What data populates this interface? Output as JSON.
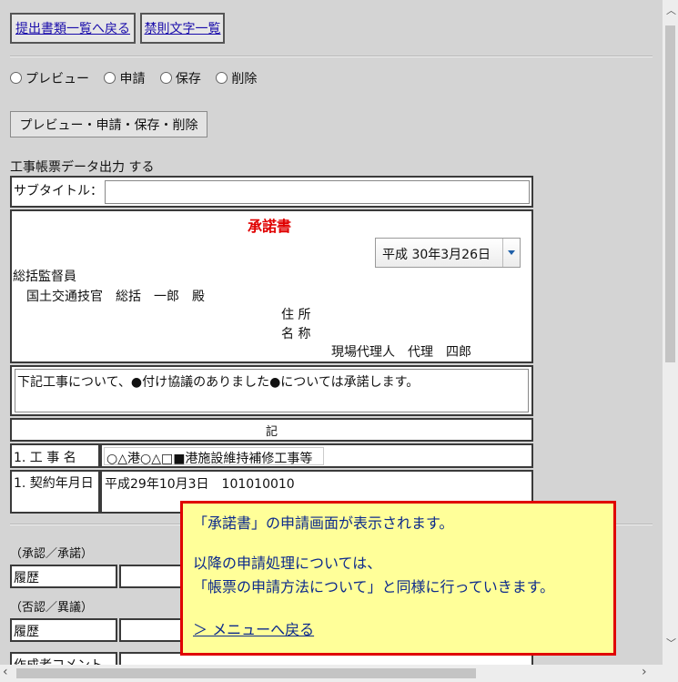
{
  "toolbar": {
    "back_to_list": "提出書類一覧へ戻る",
    "forbidden_chars": "禁則文字一覧"
  },
  "actions": {
    "radios": [
      "プレビュー",
      "申請",
      "保存",
      "削除"
    ],
    "submit_label": "プレビュー・申請・保存・削除"
  },
  "form": {
    "output_label": "工事帳票データ出力 する",
    "subtitle_label": "サブタイトル：",
    "subtitle_value": "",
    "doc_title": "承諾書",
    "date_value": "平成 30年3月26日",
    "addressee_title": "総括監督員",
    "addressee_name": "国土交通技官　総括　一郎　殿",
    "address_label": "住 所",
    "name_label": "名 称",
    "agent": "現場代理人　代理　四郎",
    "body_text": "下記工事について、●付け協議のありました●については承諾します。",
    "ki": "記",
    "row1_label": "1. 工 事 名",
    "row1_value": "○△港○△□■港施設維持補修工事等",
    "row2_label": "1. 契約年月日",
    "row2_value": "平成29年10月3日　101010010"
  },
  "history": {
    "approval_heading": "（承認／承諾）",
    "approval_label": "履歴",
    "denial_heading": "（否認／異議）",
    "denial_label": "履歴",
    "comment_label": "作成者コメント"
  },
  "popup": {
    "line1": "「承諾書」の申請画面が表示されます。",
    "line2": "以降の申請処理については、",
    "line3": "「帳票の申請方法について」と同様に行っていきます。",
    "link": "＞ メニューへ戻る"
  },
  "colors": {
    "title_red": "#e00000",
    "popup_bg": "#ffff99",
    "popup_border": "#e00000",
    "link_blue": "#0c2a8c"
  }
}
